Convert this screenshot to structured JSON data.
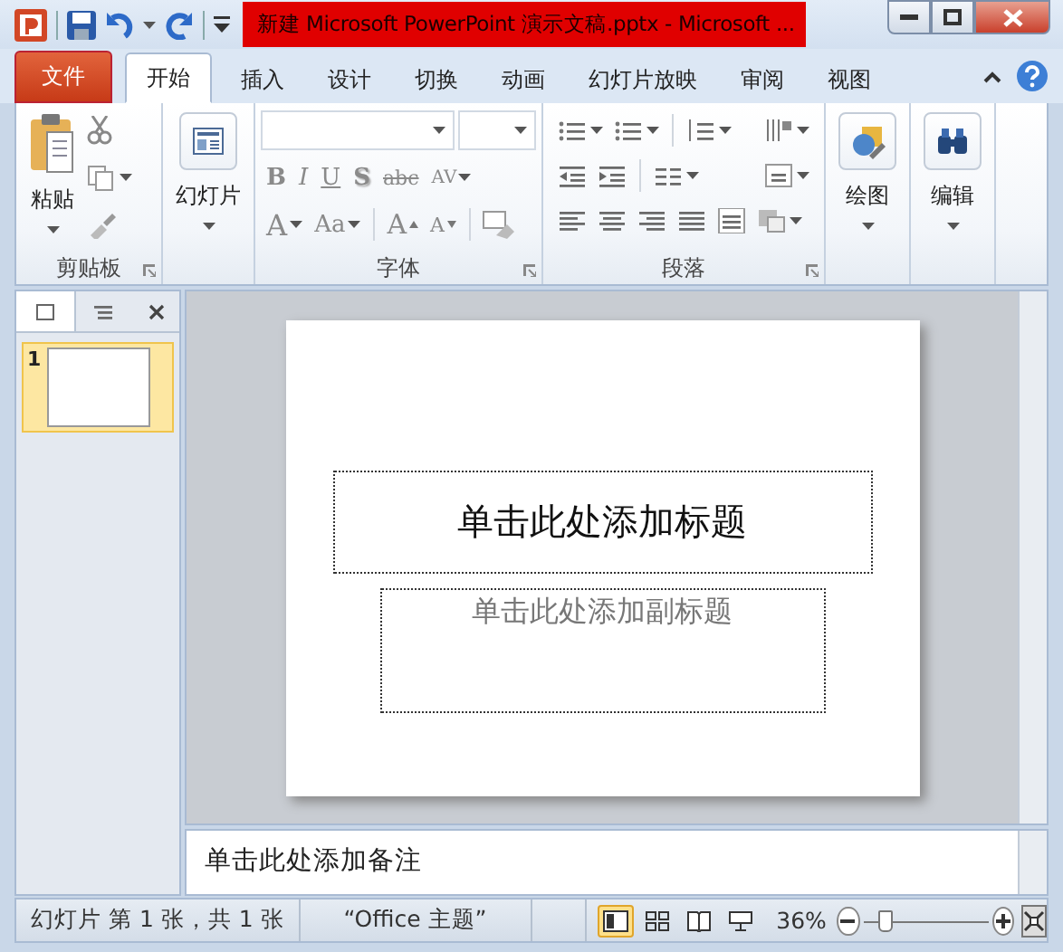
{
  "window": {
    "title": "新建 Microsoft PowerPoint 演示文稿.pptx  -  Microsoft ..."
  },
  "tabs": [
    {
      "label": "文件",
      "kind": "file",
      "selected": false
    },
    {
      "label": "开始",
      "kind": "tab",
      "selected": true
    },
    {
      "label": "插入",
      "kind": "tab",
      "selected": false
    },
    {
      "label": "设计",
      "kind": "tab",
      "selected": false
    },
    {
      "label": "切换",
      "kind": "tab",
      "selected": false
    },
    {
      "label": "动画",
      "kind": "tab",
      "selected": false
    },
    {
      "label": "幻灯片放映",
      "kind": "tab",
      "selected": false
    },
    {
      "label": "审阅",
      "kind": "tab",
      "selected": false
    },
    {
      "label": "视图",
      "kind": "tab",
      "selected": false
    }
  ],
  "ribbon": {
    "groups": [
      {
        "kind": "clipboard",
        "label": "剪贴板",
        "big_button": "粘贴"
      },
      {
        "kind": "big",
        "big_button": "幻灯片"
      },
      {
        "kind": "font",
        "label": "字体",
        "row1": [
          {
            "text": "B",
            "disabled": true
          },
          {
            "text": "I",
            "disabled": true
          },
          {
            "text": "U",
            "disabled": true
          },
          {
            "text": "S",
            "disabled": true
          },
          {
            "text": "abc",
            "disabled": true
          },
          {
            "text": "AV",
            "disabled": true
          }
        ],
        "row2": [
          {
            "text": "A",
            "disabled": true
          },
          {
            "text": "Aa",
            "disabled": true
          },
          {
            "text": "A",
            "disabled": true
          },
          {
            "text": "A",
            "disabled": true
          }
        ]
      },
      {
        "kind": "paragraph",
        "label": "段落"
      },
      {
        "kind": "big",
        "big_button": "绘图"
      },
      {
        "kind": "big",
        "big_button": "编辑"
      }
    ]
  },
  "slides_pane": {
    "thumbnails": [
      {
        "number": "1",
        "selected": true
      }
    ]
  },
  "slide": {
    "title_placeholder": "单击此处添加标题",
    "subtitle_placeholder": "单击此处添加副标题"
  },
  "notes": {
    "placeholder": "单击此处添加备注"
  },
  "status_bar": {
    "slide_info": "幻灯片 第 1 张，共 1 张",
    "theme": "“Office 主题”",
    "views": [
      {
        "selected": true
      },
      {
        "selected": false
      },
      {
        "selected": false
      },
      {
        "selected": false
      }
    ],
    "zoom": "36%",
    "zoom_slider": {
      "level": 0.18
    }
  }
}
